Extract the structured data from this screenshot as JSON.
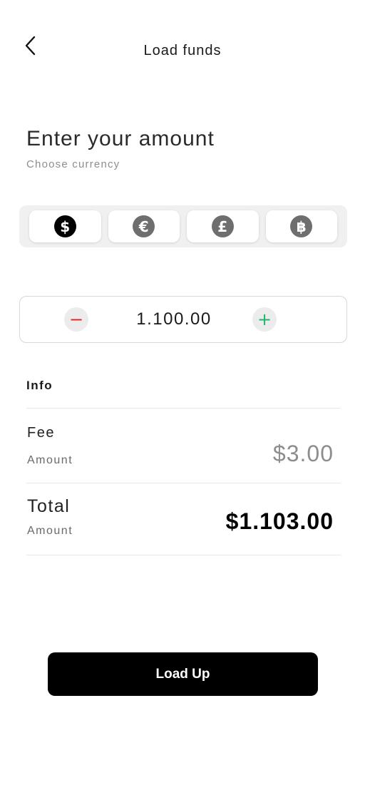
{
  "header": {
    "title": "Load funds",
    "back_icon": "chevron-left-icon"
  },
  "content": {
    "heading": "Enter your amount",
    "subheading": "Choose currency"
  },
  "currencies": [
    {
      "id": "usd",
      "symbol": "$",
      "icon": "dollar-icon",
      "selected": true
    },
    {
      "id": "eur",
      "symbol": "€",
      "icon": "euro-icon",
      "selected": false
    },
    {
      "id": "gbp",
      "symbol": "£",
      "icon": "pound-icon",
      "selected": false
    },
    {
      "id": "btc",
      "symbol": "฿",
      "icon": "bitcoin-icon",
      "selected": false
    }
  ],
  "stepper": {
    "minus_symbol": "−",
    "plus_symbol": "+",
    "value": "1.100.00"
  },
  "info": {
    "label": "Info",
    "fee": {
      "title": "Fee",
      "subtitle": "Amount",
      "value": "$3.00"
    },
    "total": {
      "title": "Total",
      "subtitle": "Amount",
      "value": "$1.103.00"
    }
  },
  "actions": {
    "load_up_label": "Load Up"
  },
  "colors": {
    "accent": "#000000",
    "minus": "#e02828",
    "plus": "#1fb66a",
    "muted": "#8d8d8d"
  }
}
